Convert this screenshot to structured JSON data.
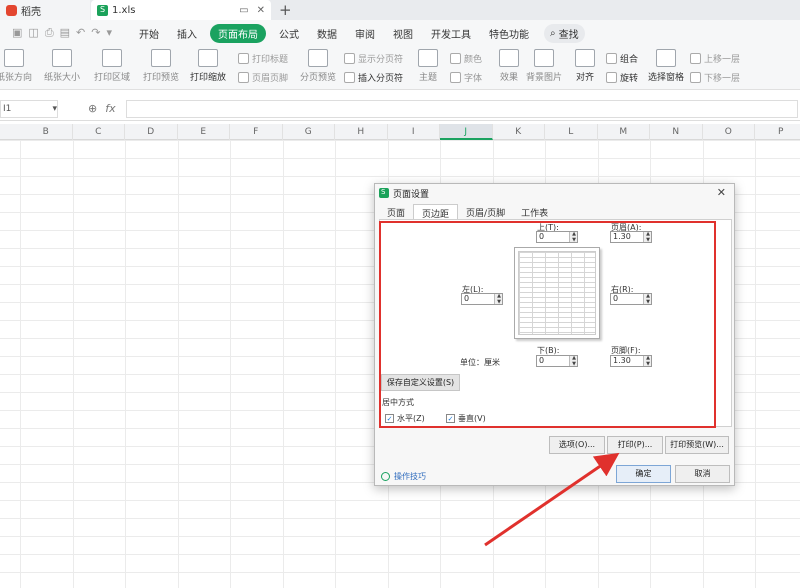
{
  "titlebar": {
    "home_tab": "稻壳",
    "file_tab": "1.xls",
    "new_tab": "+"
  },
  "menubar": {
    "items": [
      "开始",
      "插入",
      "页面布局",
      "公式",
      "数据",
      "审阅",
      "视图",
      "开发工具",
      "特色功能"
    ],
    "active": "页面布局",
    "search": "查找"
  },
  "ribbon": {
    "paper_direction": "纸张方向",
    "paper_size": "纸张大小",
    "print_area": "打印区域",
    "print_preview": "打印预览",
    "print_scale": "打印缩放",
    "print_titles": "打印标题",
    "header_footer": "页眉页脚",
    "page_break_preview": "分页预览",
    "show_page_breaks": "显示分页符",
    "insert_page_break": "插入分页符",
    "theme": "主题",
    "colors": "颜色",
    "fonts": "字体",
    "effects": "效果",
    "background": "背景图片",
    "align": "对齐",
    "group": "组合",
    "rotate": "旋转",
    "selection_pane": "选择窗格",
    "bring_forward": "上移一层",
    "send_backward": "下移一层"
  },
  "formulabar": {
    "namebox": "I1",
    "fx": "fx"
  },
  "columns": [
    "B",
    "C",
    "D",
    "E",
    "F",
    "G",
    "H",
    "I",
    "J",
    "K",
    "L",
    "M",
    "N",
    "O",
    "P"
  ],
  "selected_column": "J",
  "dialog": {
    "title": "页面设置",
    "tabs": [
      "页面",
      "页边距",
      "页眉/页脚",
      "工作表"
    ],
    "active_tab": "页边距",
    "top_label": "上(T):",
    "top_value": "0",
    "header_label": "页眉(A):",
    "header_value": "1.30",
    "left_label": "左(L):",
    "left_value": "0",
    "right_label": "右(R):",
    "right_value": "0",
    "bottom_label": "下(B):",
    "bottom_value": "0",
    "footer_label": "页脚(F):",
    "footer_value": "1.30",
    "unit_label": "单位：厘米",
    "save_custom": "保存自定义设置(S)",
    "center_label": "居中方式",
    "horizontal": "水平(Z)",
    "vertical": "垂直(V)",
    "options_btn": "选项(O)...",
    "print_btn": "打印(P)...",
    "print_preview_btn": "打印预览(W)...",
    "ok_btn": "确定",
    "cancel_btn": "取消",
    "tips": "操作技巧"
  },
  "colors": {
    "accent_green": "#1aa260",
    "highlight_red": "#e0312d"
  }
}
